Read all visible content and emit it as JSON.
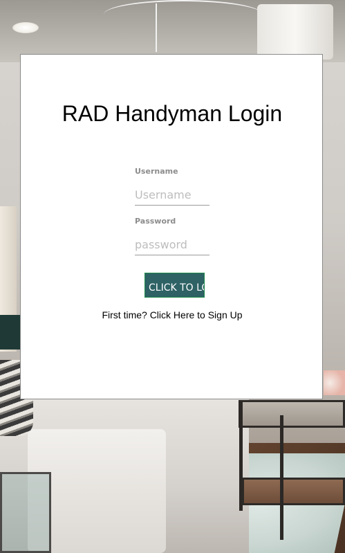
{
  "page": {
    "title": "RAD Handyman Login"
  },
  "form": {
    "username_label": "Username",
    "username_placeholder": "Username",
    "username_value": "",
    "password_label": "Password",
    "password_placeholder": "password",
    "password_value": "",
    "login_button_label": "CLICK TO LOGIN",
    "signup_link_text": "First time? Click Here to Sign Up"
  },
  "colors": {
    "button_background": "#2e6265",
    "button_border": "#1d8a4a",
    "card_background": "#ffffff",
    "label_color": "#8c8c8c"
  },
  "background": {
    "description_icon": "living-room-photo"
  }
}
